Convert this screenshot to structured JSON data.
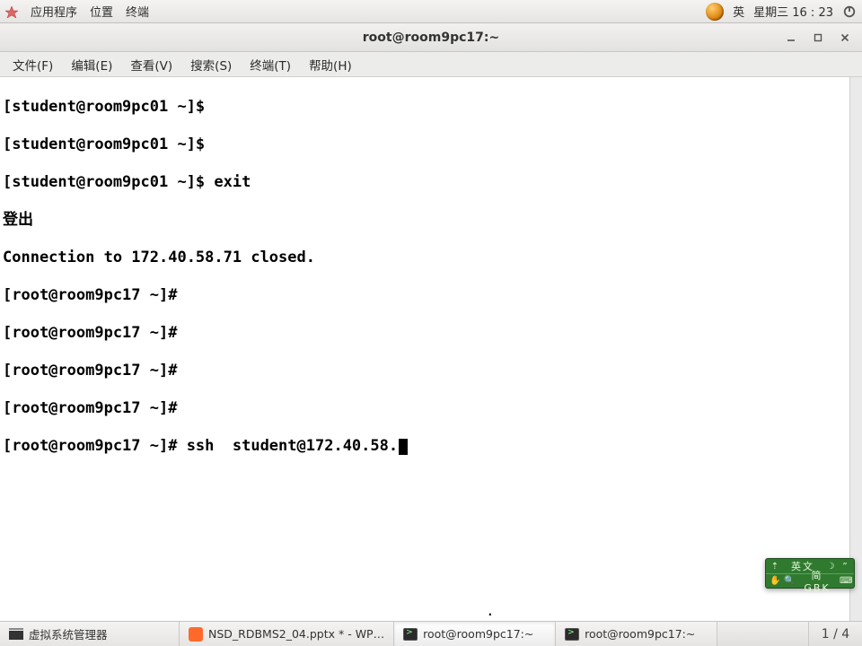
{
  "panel": {
    "applications": "应用程序",
    "places": "位置",
    "terminal": "终端",
    "lang": "英",
    "datetime": "星期三 16 : 23"
  },
  "window": {
    "title": "root@room9pc17:~"
  },
  "menubar": {
    "file": "文件(F)",
    "edit": "编辑(E)",
    "view": "查看(V)",
    "search": "搜索(S)",
    "terminal": "终端(T)",
    "help": "帮助(H)"
  },
  "terminal": {
    "lines": [
      "[student@room9pc01 ~]$ ",
      "[student@room9pc01 ~]$ ",
      "[student@room9pc01 ~]$ exit",
      "登出",
      "Connection to 172.40.58.71 closed.",
      "[root@room9pc17 ~]# ",
      "[root@room9pc17 ~]# ",
      "[root@room9pc17 ~]# ",
      "[root@room9pc17 ~]# ",
      "[root@room9pc17 ~]# ssh  student@172.40.58."
    ],
    "stray": "."
  },
  "ime": {
    "row1_label": "英文",
    "row2_label": "简 GBK"
  },
  "taskbar": {
    "items": [
      "虚拟系统管理器",
      "NSD_RDBMS2_04.pptx * - WP…",
      "root@room9pc17:~",
      "root@room9pc17:~"
    ],
    "workspace": "1 / 4"
  }
}
